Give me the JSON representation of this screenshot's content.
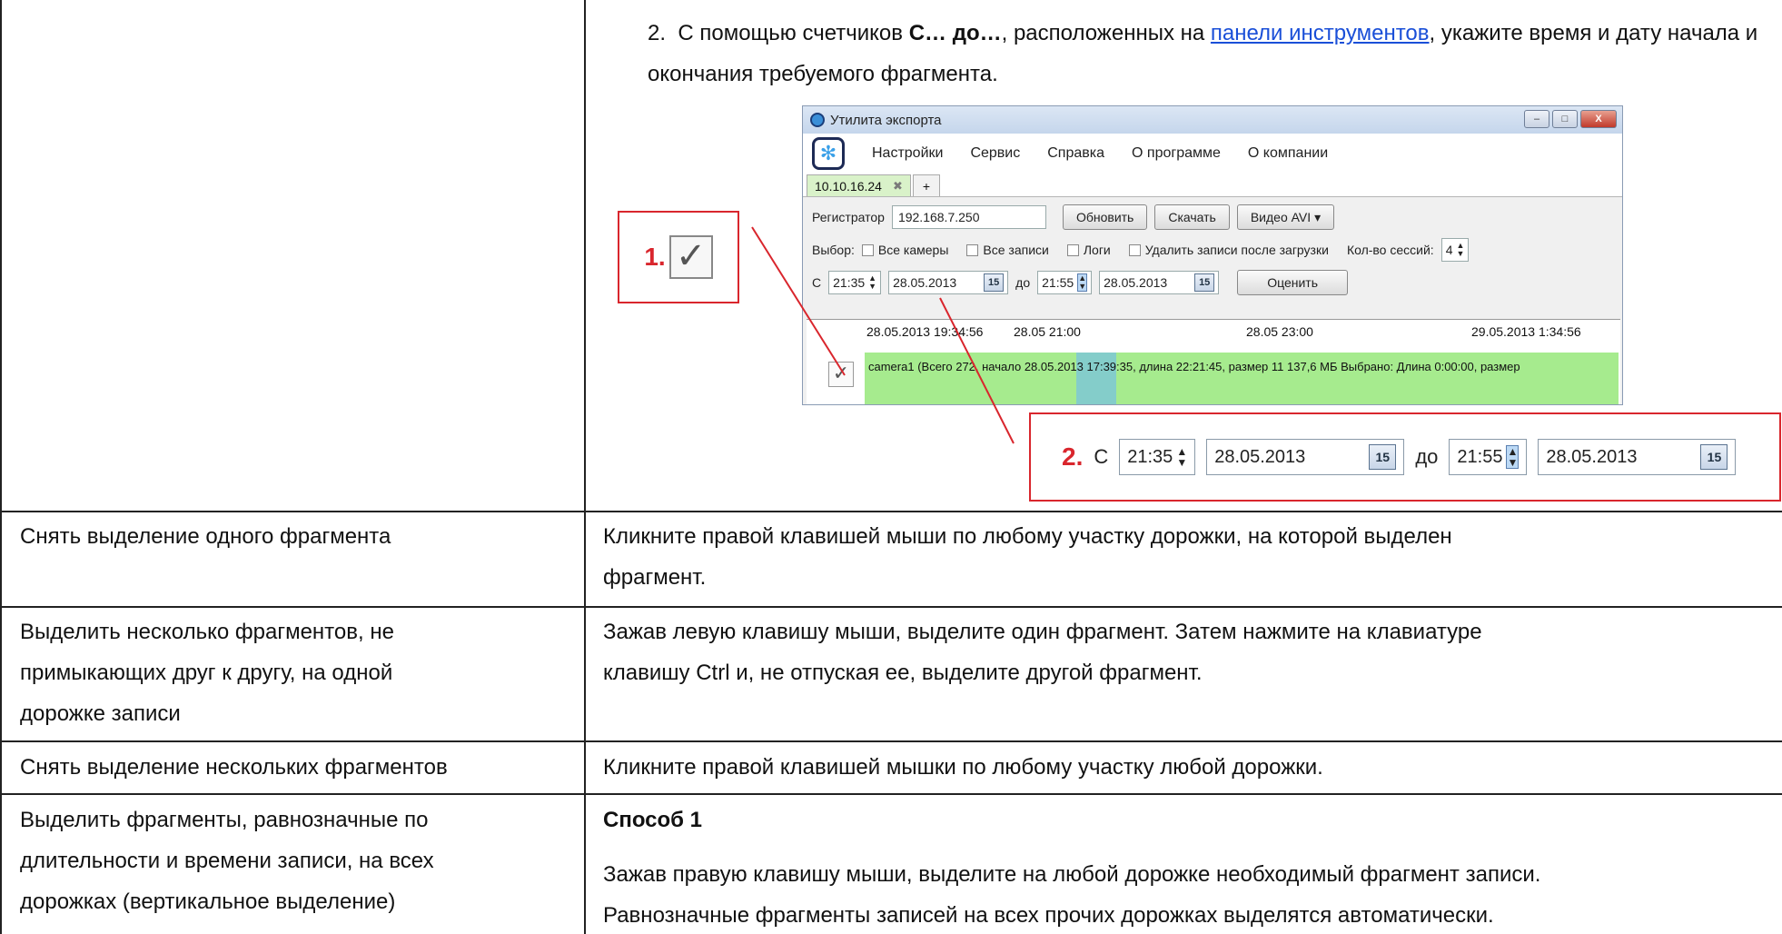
{
  "row0": {
    "step_num": "2.",
    "step_pre": "С помощью счетчиков ",
    "step_bold": "С… до…",
    "step_mid": ", расположенных на ",
    "step_link": "панели инструментов",
    "step_post": ", укажите время и дату начала и окончания требуемого фрагмента.",
    "screenshot": {
      "window_title": "Утилита экспорта",
      "window_buttons": [
        "–",
        "□",
        "X"
      ],
      "menu": [
        "Настройки",
        "Сервис",
        "Справка",
        "О программе",
        "О компании"
      ],
      "tab_label": "10.10.16.24",
      "tab_close": "✖",
      "tab_add": "+",
      "registrar_label": "Регистратор",
      "registrar_value": "192.168.7.250",
      "refresh_button": "Обновить",
      "download_button": "Скачать",
      "format_button": "Видео AVI",
      "select_label": "Выбор:",
      "check_all_cameras": "Все камеры",
      "check_all_records": "Все записи",
      "check_logs": "Логи",
      "check_delete": "Удалить записи после загрузки",
      "sessions_label": "Кол-во сессий:",
      "sessions_value": "4",
      "from_label": "С",
      "from_time": "21:35",
      "from_date": "28.05.2013",
      "cal_icon": "15",
      "to_label": "до",
      "to_time": "21:55",
      "to_date": "28.05.2013",
      "estimate_button": "Оценить",
      "timeline_ticks": [
        "28.05.2013 19:34:56",
        "28.05 21:00",
        "28.05 23:00",
        "29.05.2013 1:34:56"
      ],
      "track_text": "camera1 (Всего 272, начало 28.05.2013 17:39:35, длина 22:21:45, размер 11 137,6 МБ Выбрано: Длина 0:00:00, размер"
    },
    "callout1_num": "1.",
    "callout2_num": "2.",
    "callout2_from_label": "С",
    "callout2_from_time": "21:35",
    "callout2_from_date": "28.05.2013",
    "callout2_to_label": "до",
    "callout2_to_time": "21:55",
    "callout2_to_date": "28.05.2013",
    "callout2_cal": "15"
  },
  "rows": [
    {
      "action": "Снять выделение одного фрагмента",
      "description": "Кликните правой клавишей мыши по любому участку дорожки, на которой выделен\nфрагмент."
    },
    {
      "action": "Выделить несколько фрагментов, не\nпримыкающих друг к другу, на одной\nдорожке записи",
      "description": "Зажав левую клавишу мыши, выделите один фрагмент. Затем нажмите на клавиатуре\nклавишу Ctrl и, не отпуская ее, выделите другой фрагмент."
    },
    {
      "action": "Снять выделение нескольких фрагментов",
      "description": "Кликните правой клавишей мышки по любому участку любой дорожки."
    },
    {
      "action": "Выделить фрагменты, равнозначные по\nдлительности и времени записи, на всех\nдорожках (вертикальное выделение)",
      "description_heading": "Способ 1",
      "description": "Зажав правую клавишу мыши, выделите на любой дорожке необходимый фрагмент записи.\nРавнозначные фрагменты записей на всех прочих дорожках выделятся автоматически."
    }
  ]
}
